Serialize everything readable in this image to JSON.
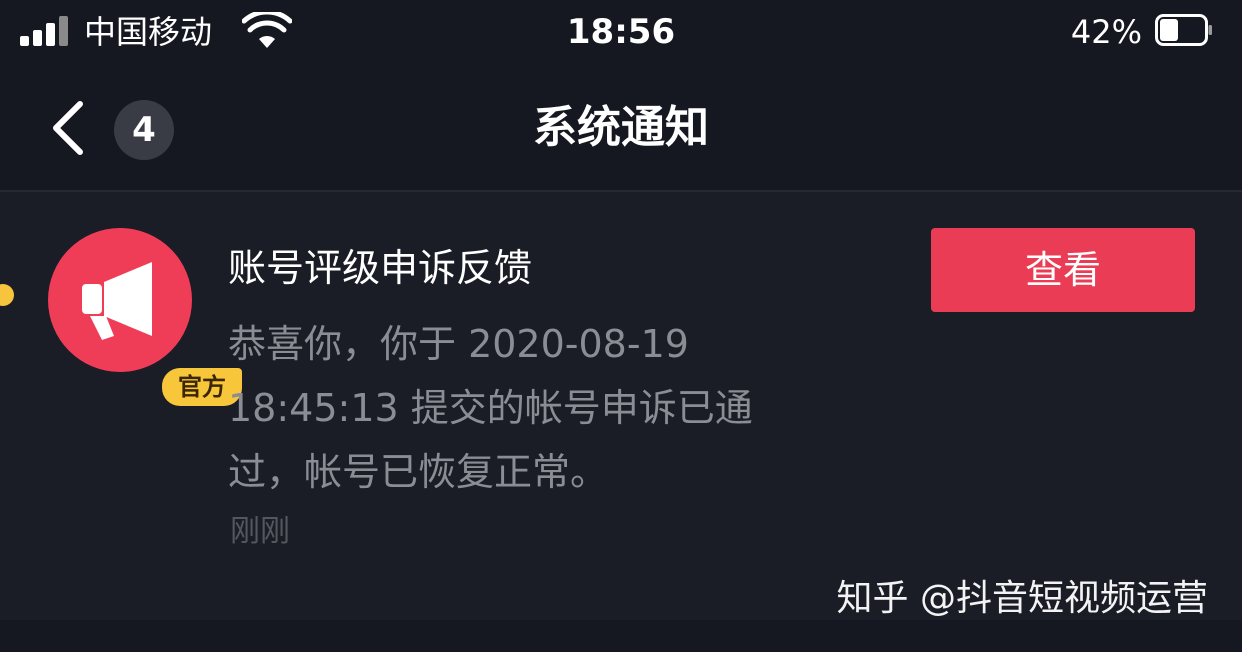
{
  "status_bar": {
    "carrier": "中国移动",
    "time": "18:56",
    "battery_percent": "42%",
    "battery_level": 0.42,
    "icons": [
      "signal-icon",
      "wifi-icon",
      "battery-icon"
    ]
  },
  "nav": {
    "back_icon": "chevron-left-icon",
    "unread_count": "4",
    "title": "系统通知"
  },
  "notification": {
    "avatar_icon": "megaphone-icon",
    "badge": "官方",
    "title": "账号评级申诉反馈",
    "body_lines": [
      "恭喜你，你于 2020-08-19",
      "18:45:13 提交的帐号申诉已通",
      "过，帐号已恢复正常。"
    ],
    "time": "刚刚",
    "action_label": "查看"
  },
  "watermark": "知乎 @抖音短视频运营",
  "colors": {
    "background": "#161821",
    "card": "#1a1c26",
    "accent": "#ea3d55",
    "badge": "#f7c63b",
    "unread_dot": "#f6c43d",
    "muted_text": "#8b8d95"
  }
}
